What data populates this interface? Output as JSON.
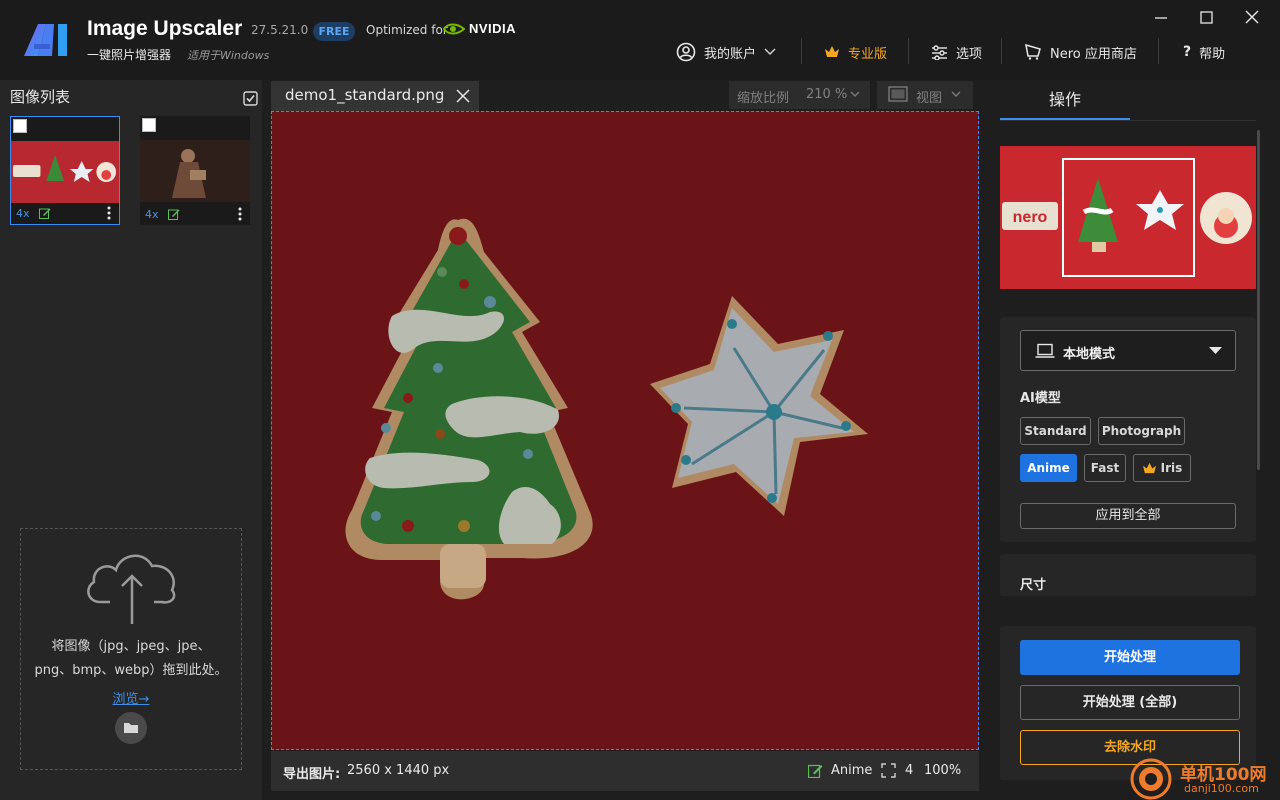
{
  "app": {
    "title": "Image Upscaler",
    "version": "27.5.21.0",
    "badge": "FREE",
    "optimized_for": "Optimized for",
    "gpu_brand": "NVIDIA",
    "subtitle": "一键照片增强器",
    "subtitle_os": "适用于Windows"
  },
  "nav": {
    "account": "我的账户",
    "pro": "专业版",
    "options": "选项",
    "store": "Nero 应用商店",
    "help": "帮助"
  },
  "left": {
    "title": "图像列表",
    "thumbnails": [
      {
        "scale": "4x",
        "selected": true
      },
      {
        "scale": "4x",
        "selected": false
      }
    ],
    "drop_text_1": "将图像（jpg、jpeg、jpe、",
    "drop_text_2": "png、bmp、webp）拖到此处。",
    "browse": "浏览→"
  },
  "center": {
    "tab_label": "demo1_standard.png",
    "zoom_label": "缩放比例",
    "zoom_value": "210 %",
    "view_label": "视图",
    "export_label": "导出图片:",
    "export_value": "2560 x 1440 px",
    "status_model": "Anime",
    "status_scale": "4",
    "status_zoom": "100%"
  },
  "right": {
    "ops_tab": "操作",
    "mode_label": "本地模式",
    "ai_model_title": "AI模型",
    "models": {
      "standard": "Standard",
      "photograph": "Photograph",
      "anime": "Anime",
      "fast": "Fast",
      "iris": "Iris"
    },
    "selected_model": "Anime",
    "apply_all": "应用到全部",
    "size_title": "尺寸",
    "start": "开始处理",
    "start_all": "开始处理 (全部)",
    "remove_watermark": "去除水印"
  },
  "site_watermark": {
    "name": "单机100网",
    "url": "danji100.com"
  },
  "colors": {
    "accent": "#1f73e0",
    "pro": "#f5a623",
    "canvas_bg": "#6a1418"
  },
  "icons": [
    "app-logo-icon",
    "user-icon",
    "crown-icon",
    "sliders-icon",
    "store-icon",
    "help-icon",
    "minimize-icon",
    "maximize-icon",
    "close-icon",
    "upload-cloud-icon",
    "folder-icon",
    "laptop-icon",
    "edit-icon",
    "expand-icon"
  ]
}
